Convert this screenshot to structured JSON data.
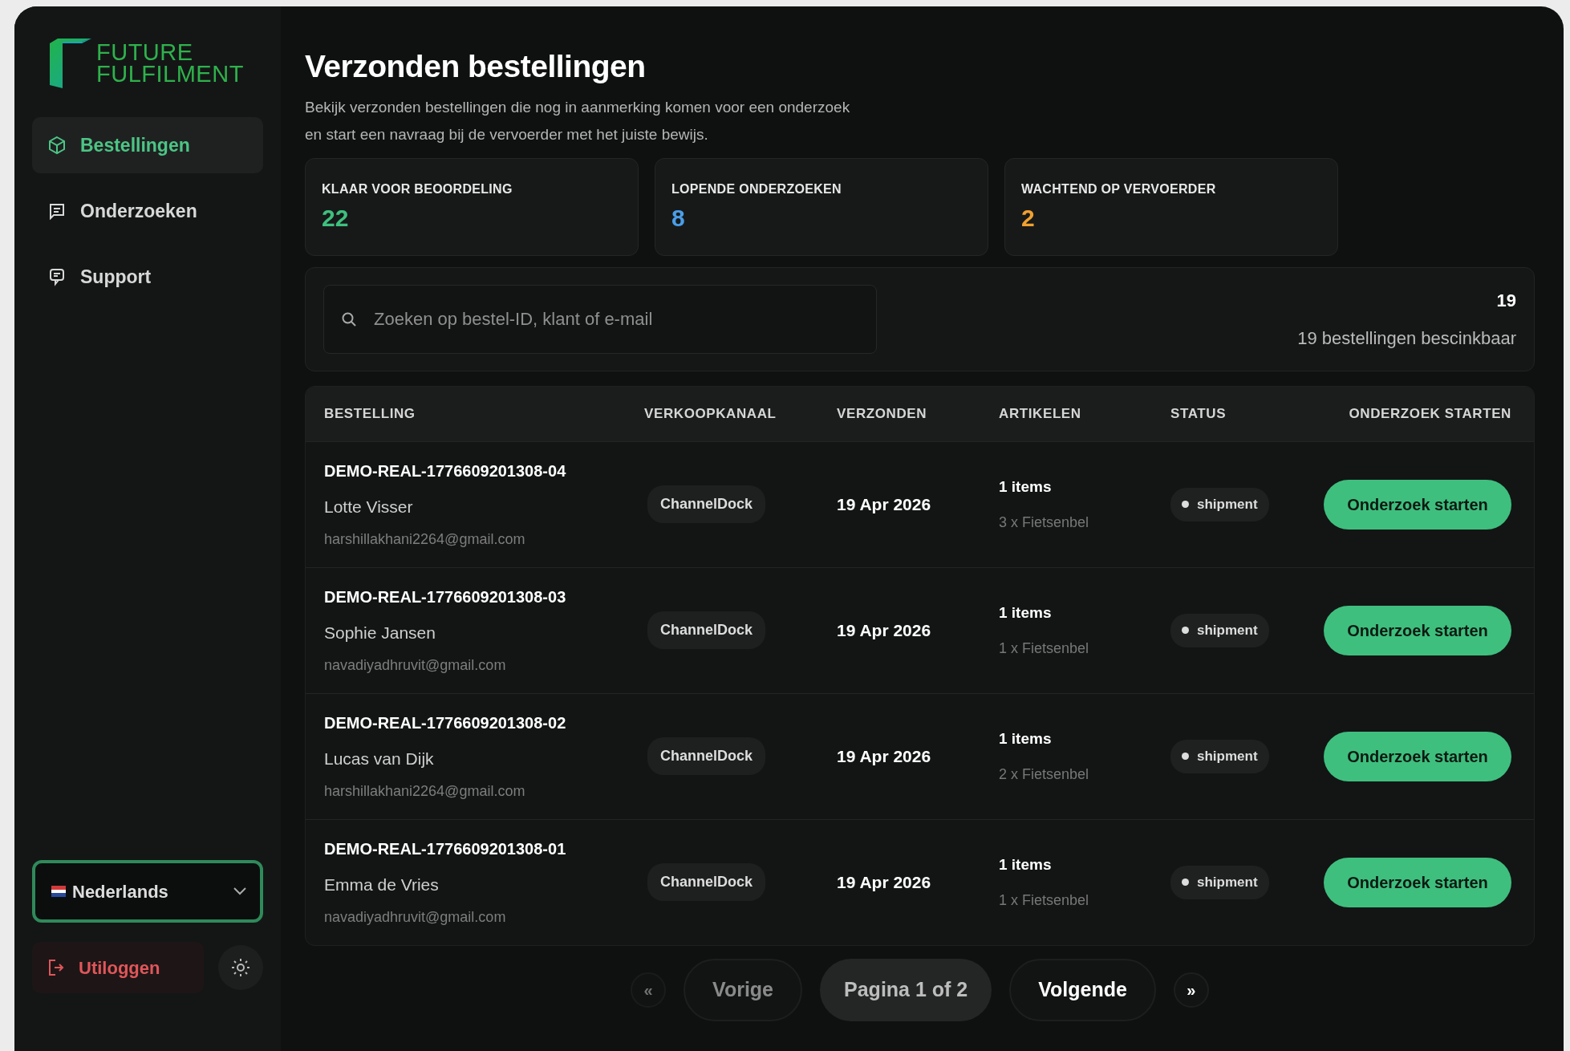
{
  "brand": {
    "lines": [
      "FUTURE",
      "FULFILMENT"
    ]
  },
  "sidebar": {
    "items": [
      {
        "label": "Bestellingen",
        "kind": "box",
        "selected": true
      },
      {
        "label": "Onderzoeken",
        "kind": "message",
        "selected": false
      },
      {
        "label": "Support",
        "kind": "chat",
        "selected": false
      }
    ],
    "language": {
      "value": "Nederlands"
    },
    "logout": "Utiloggen"
  },
  "header": {
    "title": "Verzonden bestellingen",
    "description": "Bekijk verzonden bestellingen die nog in aanmerking komen voor een onderzoek en start een navraag bij de vervoerder met het juiste bewijs."
  },
  "stats": [
    {
      "label": "KLAAR VOOR BEOORDELING",
      "value": "22",
      "color": "#3ec07f"
    },
    {
      "label": "LOPENDE ONDERZOEKEN",
      "value": "8",
      "color": "#4a9ee8"
    },
    {
      "label": "WACHTEND OP VERVOERDER",
      "value": "2",
      "color": "#f0a030"
    }
  ],
  "search": {
    "placeholder": "Zoeken op bestel-ID, klant of e-mail",
    "count": "19",
    "summary": "19 bestellingen bescinkbaar"
  },
  "table": {
    "columns": [
      "BESTELLING",
      "VERKOOPKANAAL",
      "VERZONDEN",
      "ARTIKELEN",
      "STATUS",
      "ONDERZOEK STARTEN"
    ],
    "rows": [
      {
        "order_id": "DEMO-REAL-1776609201308-04",
        "customer": "Lotte Visser",
        "email": "harshillakhani2264@gmail.com",
        "channel": "ChannelDock",
        "shipped": "19 Apr 2026",
        "items": "1 items",
        "item_detail": "3 x Fietsenbel",
        "status": "shipment",
        "action": "Onderzoek starten"
      },
      {
        "order_id": "DEMO-REAL-1776609201308-03",
        "customer": "Sophie Jansen",
        "email": "navadiyadhruvit@gmail.com",
        "channel": "ChannelDock",
        "shipped": "19 Apr 2026",
        "items": "1 items",
        "item_detail": "1 x Fietsenbel",
        "status": "shipment",
        "action": "Onderzoek starten"
      },
      {
        "order_id": "DEMO-REAL-1776609201308-02",
        "customer": "Lucas van Dijk",
        "email": "harshillakhani2264@gmail.com",
        "channel": "ChannelDock",
        "shipped": "19 Apr 2026",
        "items": "1 items",
        "item_detail": "2 x Fietsenbel",
        "status": "shipment",
        "action": "Onderzoek starten"
      },
      {
        "order_id": "DEMO-REAL-1776609201308-01",
        "customer": "Emma de Vries",
        "email": "navadiyadhruvit@gmail.com",
        "channel": "ChannelDock",
        "shipped": "19 Apr 2026",
        "items": "1 items",
        "item_detail": "1 x Fietsenbel",
        "status": "shipment",
        "action": "Onderzoek starten"
      }
    ]
  },
  "pagination": {
    "first": {
      "label": "«",
      "disabled": true
    },
    "previous": {
      "label": "Vorige",
      "disabled": true
    },
    "page": "Pagina 1 of 2",
    "next": {
      "label": "Volgende",
      "disabled": false
    },
    "last": {
      "label": "»",
      "disabled": false
    }
  }
}
